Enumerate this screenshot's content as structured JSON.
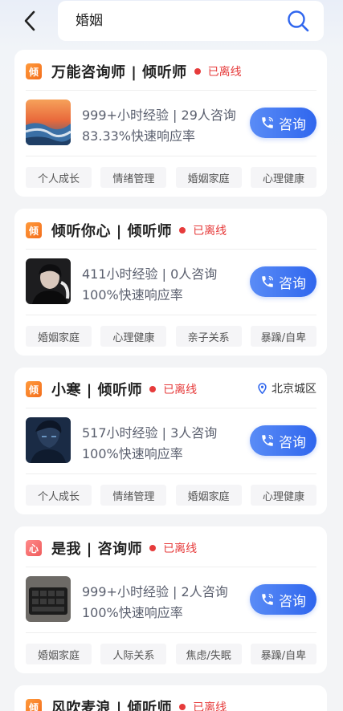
{
  "search": {
    "query": "婚姻"
  },
  "cards": [
    {
      "badge": "倾",
      "name": "万能咨询师 | 倾听师",
      "status": "已离线",
      "location": "",
      "stats": "999+小时经验 | 29人咨询",
      "response": "83.33%快速响应率",
      "button": "咨询",
      "tags": [
        "个人成长",
        "情绪管理",
        "婚姻家庭",
        "心理健康"
      ]
    },
    {
      "badge": "倾",
      "name": "倾听你心 | 倾听师",
      "status": "已离线",
      "location": "",
      "stats": "411小时经验 | 0人咨询",
      "response": "100%快速响应率",
      "button": "咨询",
      "tags": [
        "婚姻家庭",
        "心理健康",
        "亲子关系",
        "暴躁/自卑"
      ]
    },
    {
      "badge": "倾",
      "name": "小寒 | 倾听师",
      "status": "已离线",
      "location": "北京城区",
      "stats": "517小时经验 | 3人咨询",
      "response": "100%快速响应率",
      "button": "咨询",
      "tags": [
        "个人成长",
        "情绪管理",
        "婚姻家庭",
        "心理健康"
      ]
    },
    {
      "badge": "心",
      "name": "是我 | 咨询师",
      "status": "已离线",
      "location": "",
      "stats": "999+小时经验 | 2人咨询",
      "response": "100%快速响应率",
      "button": "咨询",
      "tags": [
        "婚姻家庭",
        "人际关系",
        "焦虑/失眠",
        "暴躁/自卑"
      ]
    },
    {
      "badge": "倾",
      "name": "风吹麦浪 | 倾听师",
      "status": "已离线"
    }
  ],
  "colors": {
    "accent": "#2f66ee",
    "offline": "#e63b3b",
    "badge_orange": "#f36d1b",
    "badge_red": "#ef5b5b"
  },
  "icons": {
    "back": "chevron-left-icon",
    "search": "search-icon",
    "phone": "phone-icon",
    "location": "location-pin-icon"
  }
}
